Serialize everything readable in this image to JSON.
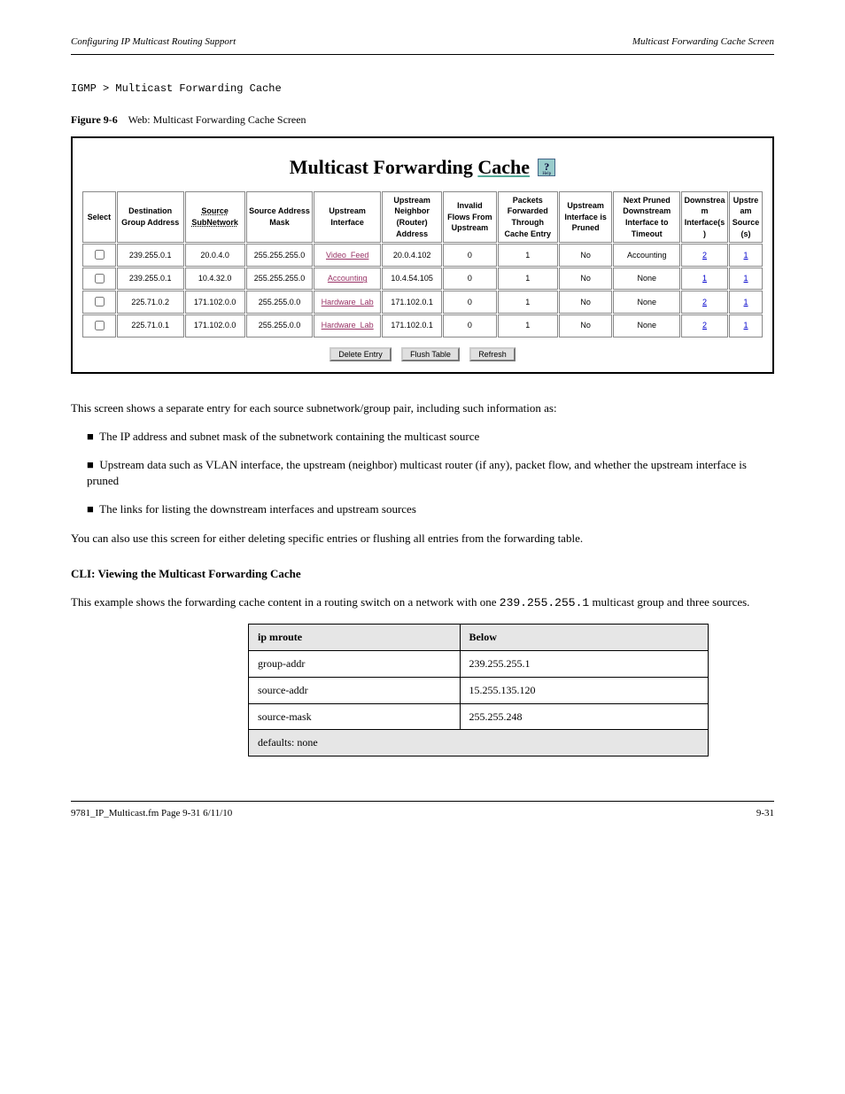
{
  "header": {
    "left": "Configuring IP Multicast Routing Support",
    "right": "Multicast Forwarding Cache Screen"
  },
  "screen_path_label": "IGMP > Multicast Forwarding Cache",
  "figure_caption_label": "Figure 9-6",
  "figure_caption_text": "Web: Multicast Forwarding Cache Screen",
  "screenshot": {
    "title_prefix": "Multicast Forwarding ",
    "title_underline": "Cache",
    "help_alt": "Help",
    "headers": {
      "select": "Select",
      "dest": "Destination Group Address",
      "src_subnet": "Source SubNetwork",
      "src_mask": "Source Address Mask",
      "up_if": "Upstream Interface",
      "up_neighbor": "Upstream Neighbor (Router) Address",
      "invalid": "Invalid Flows From Upstream",
      "pkts": "Packets Forwarded Through Cache Entry",
      "pruned": "Upstream Interface is Pruned",
      "next_pruned": "Next Pruned Downstream Interface to Timeout",
      "down_if": "Downstream Interface(s)",
      "up_src": "Upstream Source(s)"
    },
    "rows": [
      {
        "dest": "239.255.0.1",
        "srcnet": "20.0.4.0",
        "mask": "255.255.255.0",
        "upif": "Video_Feed",
        "upnb": "20.0.4.102",
        "inv": "0",
        "pkt": "1",
        "pr": "No",
        "np": "Accounting",
        "dn": "2",
        "us": "1"
      },
      {
        "dest": "239.255.0.1",
        "srcnet": "10.4.32.0",
        "mask": "255.255.255.0",
        "upif": "Accounting",
        "upnb": "10.4.54.105",
        "inv": "0",
        "pkt": "1",
        "pr": "No",
        "np": "None",
        "dn": "1",
        "us": "1"
      },
      {
        "dest": "225.71.0.2",
        "srcnet": "171.102.0.0",
        "mask": "255.255.0.0",
        "upif": "Hardware_Lab",
        "upnb": "171.102.0.1",
        "inv": "0",
        "pkt": "1",
        "pr": "No",
        "np": "None",
        "dn": "2",
        "us": "1"
      },
      {
        "dest": "225.71.0.1",
        "srcnet": "171.102.0.0",
        "mask": "255.255.0.0",
        "upif": "Hardware_Lab",
        "upnb": "171.102.0.1",
        "inv": "0",
        "pkt": "1",
        "pr": "No",
        "np": "None",
        "dn": "2",
        "us": "1"
      }
    ],
    "buttons": {
      "delete": "Delete Entry",
      "flush": "Flush Table",
      "refresh": "Refresh"
    }
  },
  "body": {
    "p1": "This screen shows a separate entry for each source subnetwork/group pair, including such information as:",
    "b1": "The IP address and subnet mask of the subnetwork containing the multicast source",
    "b2": "Upstream data such as VLAN interface, the upstream (neighbor) multicast router (if any), packet flow, and whether the upstream interface is pruned",
    "b3": "The links for listing the downstream interfaces and upstream sources",
    "p2": "You can also use this screen for either deleting specific entries or flushing all entries from the forwarding table.",
    "sec_hd": "CLI: Viewing the Multicast Forwarding Cache",
    "p3_a": "This example shows the forwarding cache content in a routing switch on a network with one ",
    "p3_code": "239.255.255.1",
    "p3_b": " multicast group and three sources."
  },
  "defaults": {
    "th0": "ip mroute",
    "th1": "Below",
    "r0a": "group-addr",
    "r0b": "239.255.255.1",
    "r1a": "source-addr",
    "r1b": "15.255.135.120",
    "r2a": "source-mask",
    "r2b": "255.255.248",
    "spanner": "defaults: none"
  },
  "footer": {
    "left": "9781_IP_Multicast.fm  Page 9-31  6/11/10",
    "right": "9-31"
  }
}
